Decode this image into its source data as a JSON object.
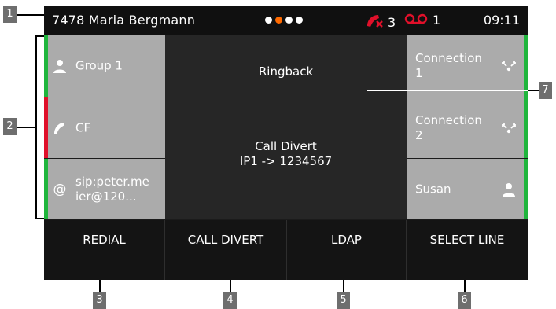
{
  "status_bar": {
    "caller": "7478 Maria Bergmann",
    "missed_calls": "3",
    "voicemails": "1",
    "time": "09:11",
    "accent": "#ff6a00",
    "alert_color": "#e0102a"
  },
  "left_keys": [
    {
      "label": "Group 1",
      "icon": "person-icon",
      "status": "green"
    },
    {
      "label": "CF",
      "icon": "handset-icon",
      "status": "red"
    },
    {
      "label": "sip:peter.me\nier@120...",
      "icon": "at-icon",
      "status": "green"
    }
  ],
  "right_keys": [
    {
      "label": "Connection\n1",
      "icon": "connection-icon",
      "status": "green"
    },
    {
      "label": "Connection\n2",
      "icon": "connection-icon",
      "status": "green"
    },
    {
      "label": "Susan",
      "icon": "person-icon",
      "status": "green"
    }
  ],
  "center": {
    "ringback": "Ringback",
    "divert_title": "Call Divert",
    "divert_detail": "IP1 -> 1234567"
  },
  "softkeys": [
    "REDIAL",
    "CALL DIVERT",
    "LDAP",
    "SELECT LINE"
  ],
  "callouts": [
    "1",
    "2",
    "3",
    "4",
    "5",
    "6",
    "7"
  ]
}
